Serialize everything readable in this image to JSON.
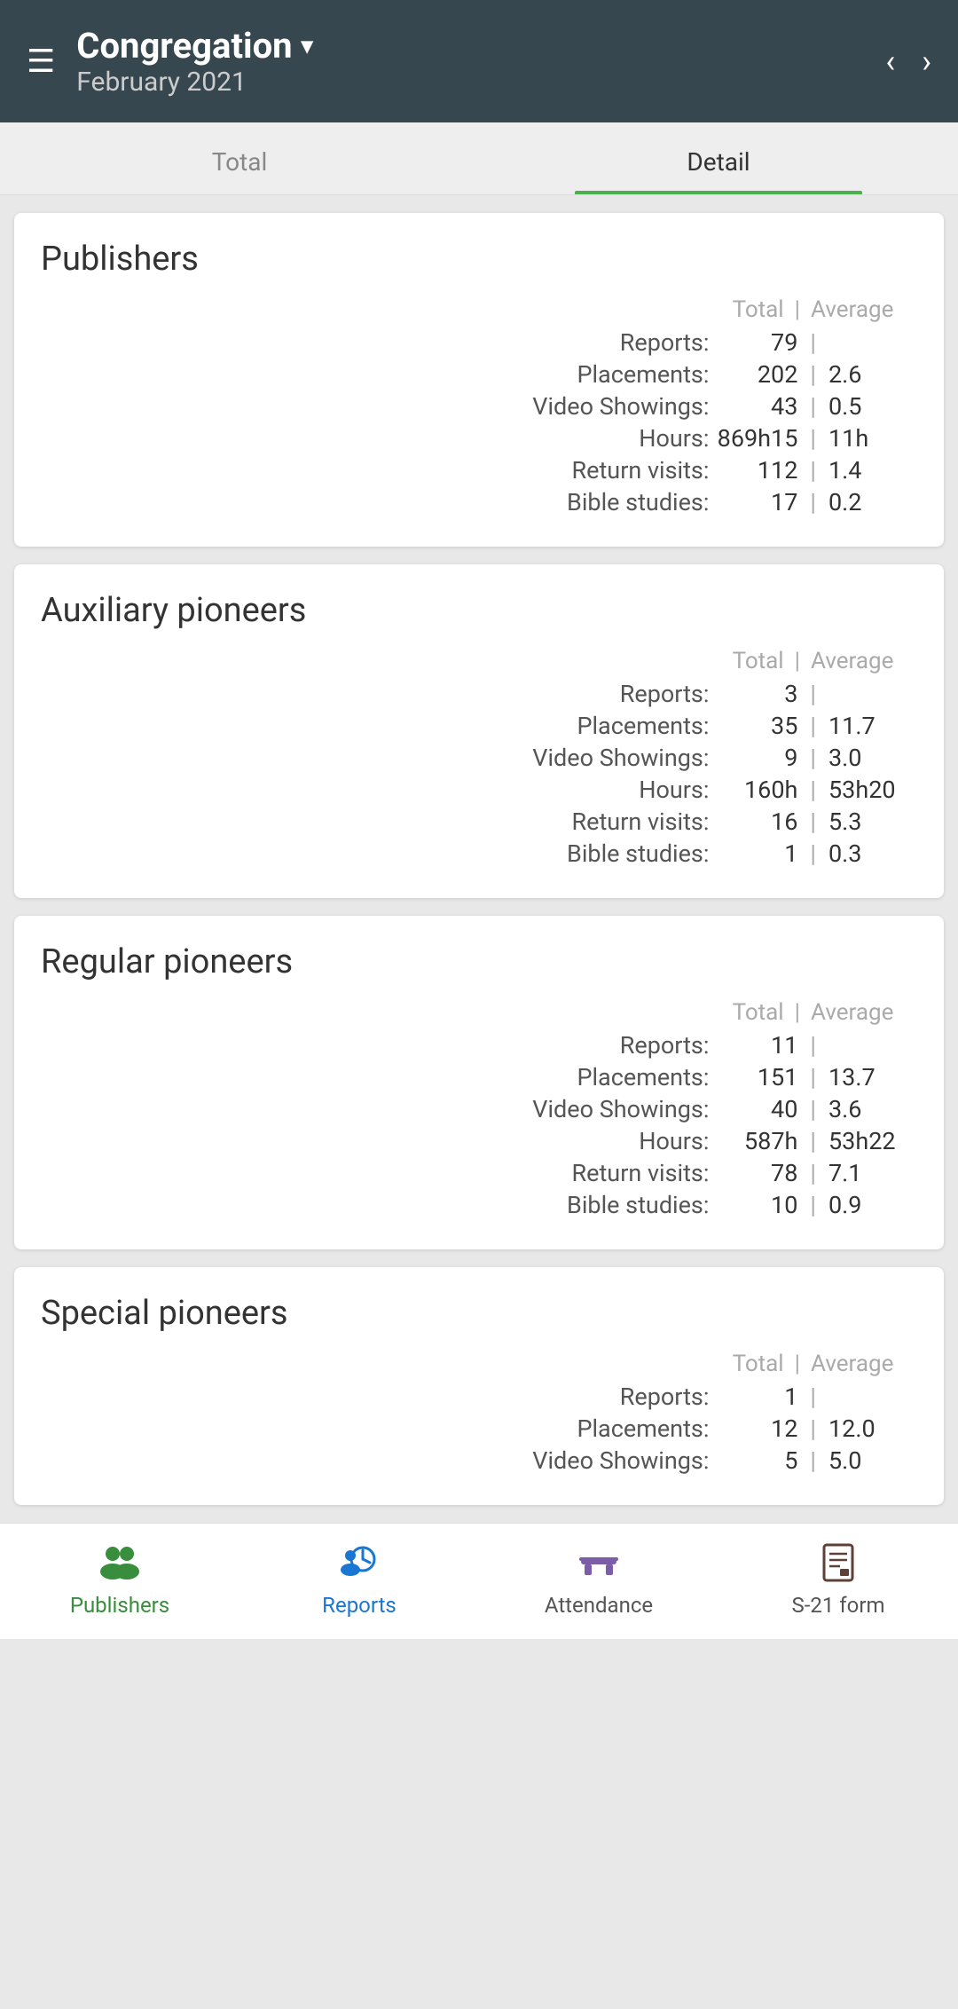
{
  "header": {
    "congregation": "Congregation",
    "month": "February 2021",
    "hamburger": "☰",
    "dropdown": "▾",
    "prev": "‹",
    "next": "›"
  },
  "tabs": [
    {
      "id": "total",
      "label": "Total",
      "active": false
    },
    {
      "id": "detail",
      "label": "Detail",
      "active": true
    }
  ],
  "sections": [
    {
      "id": "publishers",
      "title": "Publishers",
      "header": {
        "total": "Total",
        "sep": "|",
        "avg": "Average"
      },
      "rows": [
        {
          "label": "Reports:",
          "total": "79",
          "sep": "|",
          "avg": ""
        },
        {
          "label": "Placements:",
          "total": "202",
          "sep": "|",
          "avg": "2.6"
        },
        {
          "label": "Video Showings:",
          "total": "43",
          "sep": "|",
          "avg": "0.5"
        },
        {
          "label": "Hours:",
          "total": "869h15",
          "sep": "|",
          "avg": "11h"
        },
        {
          "label": "Return visits:",
          "total": "112",
          "sep": "|",
          "avg": "1.4"
        },
        {
          "label": "Bible studies:",
          "total": "17",
          "sep": "|",
          "avg": "0.2"
        }
      ]
    },
    {
      "id": "auxiliary-pioneers",
      "title": "Auxiliary pioneers",
      "header": {
        "total": "Total",
        "sep": "|",
        "avg": "Average"
      },
      "rows": [
        {
          "label": "Reports:",
          "total": "3",
          "sep": "|",
          "avg": ""
        },
        {
          "label": "Placements:",
          "total": "35",
          "sep": "|",
          "avg": "11.7"
        },
        {
          "label": "Video Showings:",
          "total": "9",
          "sep": "|",
          "avg": "3.0"
        },
        {
          "label": "Hours:",
          "total": "160h",
          "sep": "|",
          "avg": "53h20"
        },
        {
          "label": "Return visits:",
          "total": "16",
          "sep": "|",
          "avg": "5.3"
        },
        {
          "label": "Bible studies:",
          "total": "1",
          "sep": "|",
          "avg": "0.3"
        }
      ]
    },
    {
      "id": "regular-pioneers",
      "title": "Regular pioneers",
      "header": {
        "total": "Total",
        "sep": "|",
        "avg": "Average"
      },
      "rows": [
        {
          "label": "Reports:",
          "total": "11",
          "sep": "|",
          "avg": ""
        },
        {
          "label": "Placements:",
          "total": "151",
          "sep": "|",
          "avg": "13.7"
        },
        {
          "label": "Video Showings:",
          "total": "40",
          "sep": "|",
          "avg": "3.6"
        },
        {
          "label": "Hours:",
          "total": "587h",
          "sep": "|",
          "avg": "53h22"
        },
        {
          "label": "Return visits:",
          "total": "78",
          "sep": "|",
          "avg": "7.1"
        },
        {
          "label": "Bible studies:",
          "total": "10",
          "sep": "|",
          "avg": "0.9"
        }
      ]
    },
    {
      "id": "special-pioneers",
      "title": "Special pioneers",
      "header": {
        "total": "Total",
        "sep": "|",
        "avg": "Average"
      },
      "rows": [
        {
          "label": "Reports:",
          "total": "1",
          "sep": "|",
          "avg": ""
        },
        {
          "label": "Placements:",
          "total": "12",
          "sep": "|",
          "avg": "12.0"
        },
        {
          "label": "Video Showings:",
          "total": "5",
          "sep": "|",
          "avg": "5.0"
        }
      ]
    }
  ],
  "bottom_nav": [
    {
      "id": "publishers",
      "label": "Publishers",
      "icon": "people"
    },
    {
      "id": "reports",
      "label": "Reports",
      "icon": "clock-person"
    },
    {
      "id": "attendance",
      "label": "Attendance",
      "icon": "seats"
    },
    {
      "id": "s21form",
      "label": "S-21 form",
      "icon": "doc"
    }
  ]
}
